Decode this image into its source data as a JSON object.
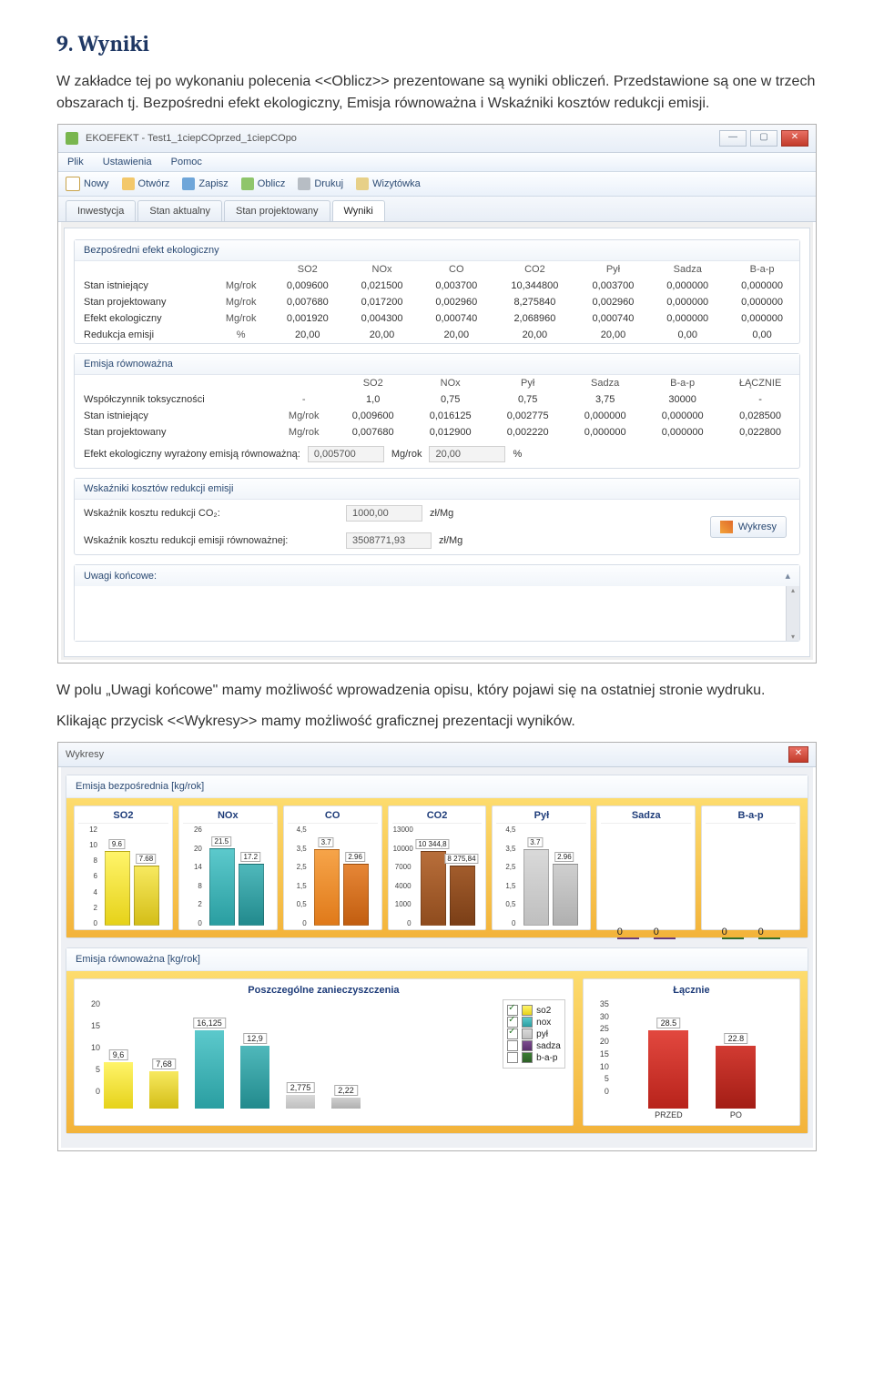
{
  "doc": {
    "heading": "9. Wyniki",
    "para1": "W zakładce tej po wykonaniu polecenia <<Oblicz>> prezentowane są wyniki obliczeń. Przedstawione są one w trzech obszarach tj. Bezpośredni efekt ekologiczny, Emisja równoważna i Wskaźniki kosztów redukcji emisji.",
    "para2": "W polu „Uwagi końcowe\" mamy możliwość wprowadzenia opisu, który pojawi się na ostatniej stronie wydruku.",
    "para3": "Klikając przycisk <<Wykresy>> mamy możliwość graficznej prezentacji wyników."
  },
  "app": {
    "title": "EKOEFEKT - Test1_1ciepCOprzed_1ciepCOpo",
    "menu": [
      "Plik",
      "Ustawienia",
      "Pomoc"
    ],
    "toolbar": [
      "Nowy",
      "Otwórz",
      "Zapisz",
      "Oblicz",
      "Drukuj",
      "Wizytówka"
    ],
    "tabs": [
      "Inwestycja",
      "Stan aktualny",
      "Stan projektowany",
      "Wyniki"
    ],
    "activeTab": 3,
    "groups": {
      "g1": "Bezpośredni efekt ekologiczny",
      "g2": "Emisja równoważna",
      "g3": "Wskaźniki kosztów redukcji emisji",
      "g4": "Uwagi końcowe:"
    },
    "t1": {
      "cols": [
        "",
        "",
        "SO2",
        "NOx",
        "CO",
        "CO2",
        "Pył",
        "Sadza",
        "B-a-p"
      ],
      "rows": [
        [
          "Stan istniejący",
          "Mg/rok",
          "0,009600",
          "0,021500",
          "0,003700",
          "10,344800",
          "0,003700",
          "0,000000",
          "0,000000"
        ],
        [
          "Stan projektowany",
          "Mg/rok",
          "0,007680",
          "0,017200",
          "0,002960",
          "8,275840",
          "0,002960",
          "0,000000",
          "0,000000"
        ],
        [
          "Efekt ekologiczny",
          "Mg/rok",
          "0,001920",
          "0,004300",
          "0,000740",
          "2,068960",
          "0,000740",
          "0,000000",
          "0,000000"
        ],
        [
          "Redukcja emisji",
          "%",
          "20,00",
          "20,00",
          "20,00",
          "20,00",
          "20,00",
          "0,00",
          "0,00"
        ]
      ]
    },
    "t2": {
      "cols": [
        "",
        "",
        "SO2",
        "NOx",
        "Pył",
        "Sadza",
        "B-a-p",
        "ŁĄCZNIE"
      ],
      "rows": [
        [
          "Współczynnik toksyczności",
          "-",
          "1,0",
          "0,75",
          "0,75",
          "3,75",
          "30000",
          "-"
        ],
        [
          "Stan istniejący",
          "Mg/rok",
          "0,009600",
          "0,016125",
          "0,002775",
          "0,000000",
          "0,000000",
          "0,028500"
        ],
        [
          "Stan projektowany",
          "Mg/rok",
          "0,007680",
          "0,012900",
          "0,002220",
          "0,000000",
          "0,000000",
          "0,022800"
        ]
      ]
    },
    "eq": {
      "label": "Efekt ekologiczny wyrażony emisją równoważną:",
      "v1": "0,005700",
      "u1": "Mg/rok",
      "v2": "20,00",
      "u2": "%"
    },
    "ind": {
      "l1": "Wskaźnik kosztu redukcji CO₂:",
      "v1": "1000,00",
      "u1": "zł/Mg",
      "l2": "Wskaźnik kosztu redukcji emisji równoważnej:",
      "v2": "3508771,93",
      "u2": "zł/Mg",
      "btn": "Wykresy"
    }
  },
  "dlg": {
    "title": "Wykresy",
    "sec1": "Emisja bezpośrednia [kg/rok]",
    "sec2": "Emisja równoważna [kg/rok]",
    "p1": "Poszczególne zanieczyszczenia",
    "p2": "Łącznie",
    "legend": [
      "so2",
      "nox",
      "pył",
      "sadza",
      "b-a-p"
    ],
    "xlab2": [
      "PRZED",
      "PO"
    ]
  },
  "chart_data": {
    "direct_emission": {
      "type": "bar",
      "title": "Emisja bezpośrednia [kg/rok]",
      "series_names": [
        "PRZED",
        "PO"
      ],
      "charts": [
        {
          "name": "SO2",
          "values": [
            9.6,
            7.68
          ],
          "yticks": [
            0,
            1,
            2,
            3,
            4,
            5,
            6,
            7,
            8,
            9,
            10,
            11,
            12
          ]
        },
        {
          "name": "NOx",
          "values": [
            21.5,
            17.2
          ],
          "yticks": [
            0,
            2,
            4,
            6,
            8,
            10,
            12,
            14,
            16,
            18,
            20,
            22,
            24,
            26
          ]
        },
        {
          "name": "CO",
          "values": [
            3.7,
            2.96
          ],
          "yticks": [
            0,
            0.5,
            1,
            1.5,
            2,
            2.5,
            3,
            3.5,
            4,
            4.5
          ]
        },
        {
          "name": "CO2",
          "values": [
            10344.8,
            8275.84
          ],
          "yticks": [
            0,
            1000,
            2000,
            3000,
            4000,
            5000,
            6000,
            7000,
            8000,
            9000,
            10000,
            11000,
            12000,
            13000
          ]
        },
        {
          "name": "Pył",
          "values": [
            3.7,
            2.96
          ],
          "yticks": [
            0,
            0.5,
            1,
            1.5,
            2,
            2.5,
            3,
            3.5,
            4,
            4.5
          ]
        },
        {
          "name": "Sadza",
          "values": [
            0,
            0
          ],
          "yticks": [
            0
          ]
        },
        {
          "name": "B-a-p",
          "values": [
            0,
            0
          ],
          "yticks": [
            0
          ]
        }
      ]
    },
    "equivalent_emission": {
      "type": "bar",
      "title": "Emisja równoważna [kg/rok]",
      "by_pollutant": {
        "title": "Poszczególne zanieczyszczenia",
        "categories": [
          "so2",
          "nox",
          "pył",
          "sadza",
          "b-a-p"
        ],
        "series": [
          {
            "name": "PRZED",
            "values": [
              9.6,
              16.125,
              2.775,
              0,
              0
            ]
          },
          {
            "name": "PO",
            "values": [
              7.68,
              12.9,
              2.22,
              0,
              0
            ]
          }
        ],
        "yticks": [
          0,
          5,
          10,
          15,
          20
        ]
      },
      "total": {
        "title": "Łącznie",
        "categories": [
          "PRZED",
          "PO"
        ],
        "values": [
          28.5,
          22.8
        ],
        "yticks": [
          0,
          5,
          10,
          15,
          20,
          25,
          30,
          35
        ]
      }
    }
  }
}
